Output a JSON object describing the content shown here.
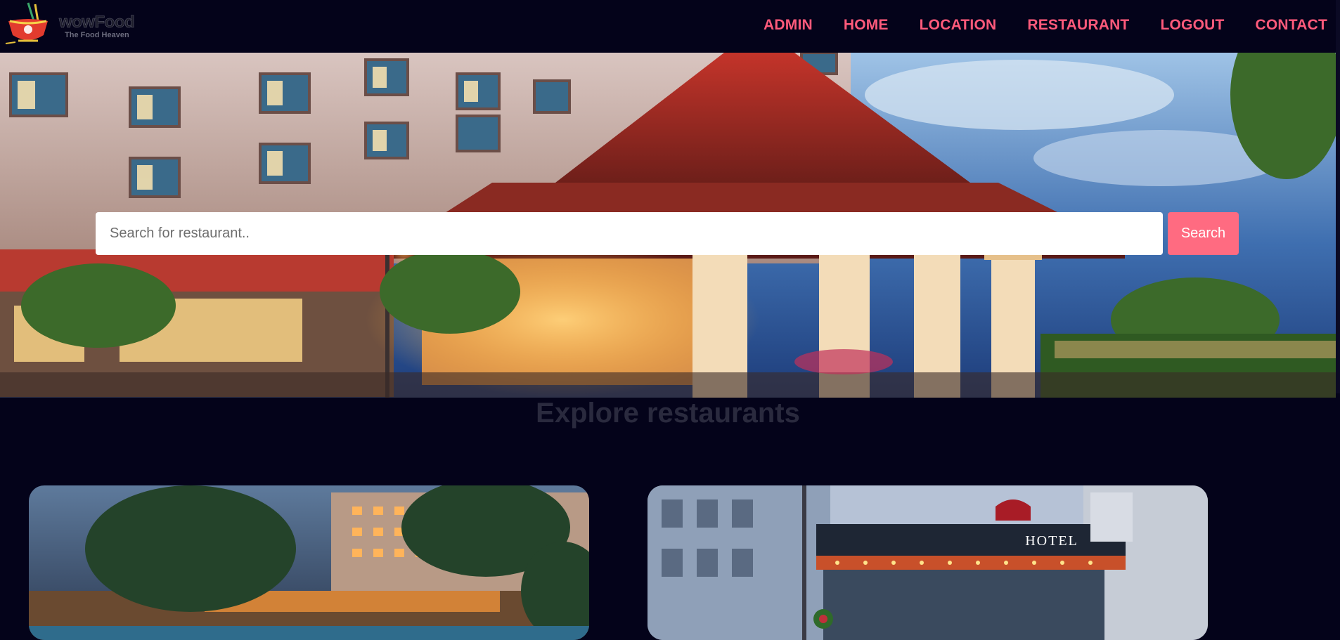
{
  "brand": {
    "name": "wowFood",
    "tagline": "The Food Heaven",
    "logo_icon": "noodle-bowl-icon"
  },
  "nav": {
    "links": [
      "ADMIN",
      "HOME",
      "LOCATION",
      "RESTAURANT",
      "LOGOUT",
      "CONTACT"
    ]
  },
  "search": {
    "placeholder": "Search for restaurant..",
    "value": "",
    "button_label": "Search"
  },
  "section": {
    "title": "Explore restaurants"
  },
  "cards": [
    {
      "image": "resort-hotel-pool-night"
    },
    {
      "image": "hotel-entrance-marquee",
      "sign_text": "HOTEL"
    }
  ],
  "colors": {
    "background": "#04031a",
    "accent": "#ff5a7b",
    "button": "#ff6b81",
    "section_title": "#2a2a3e"
  }
}
